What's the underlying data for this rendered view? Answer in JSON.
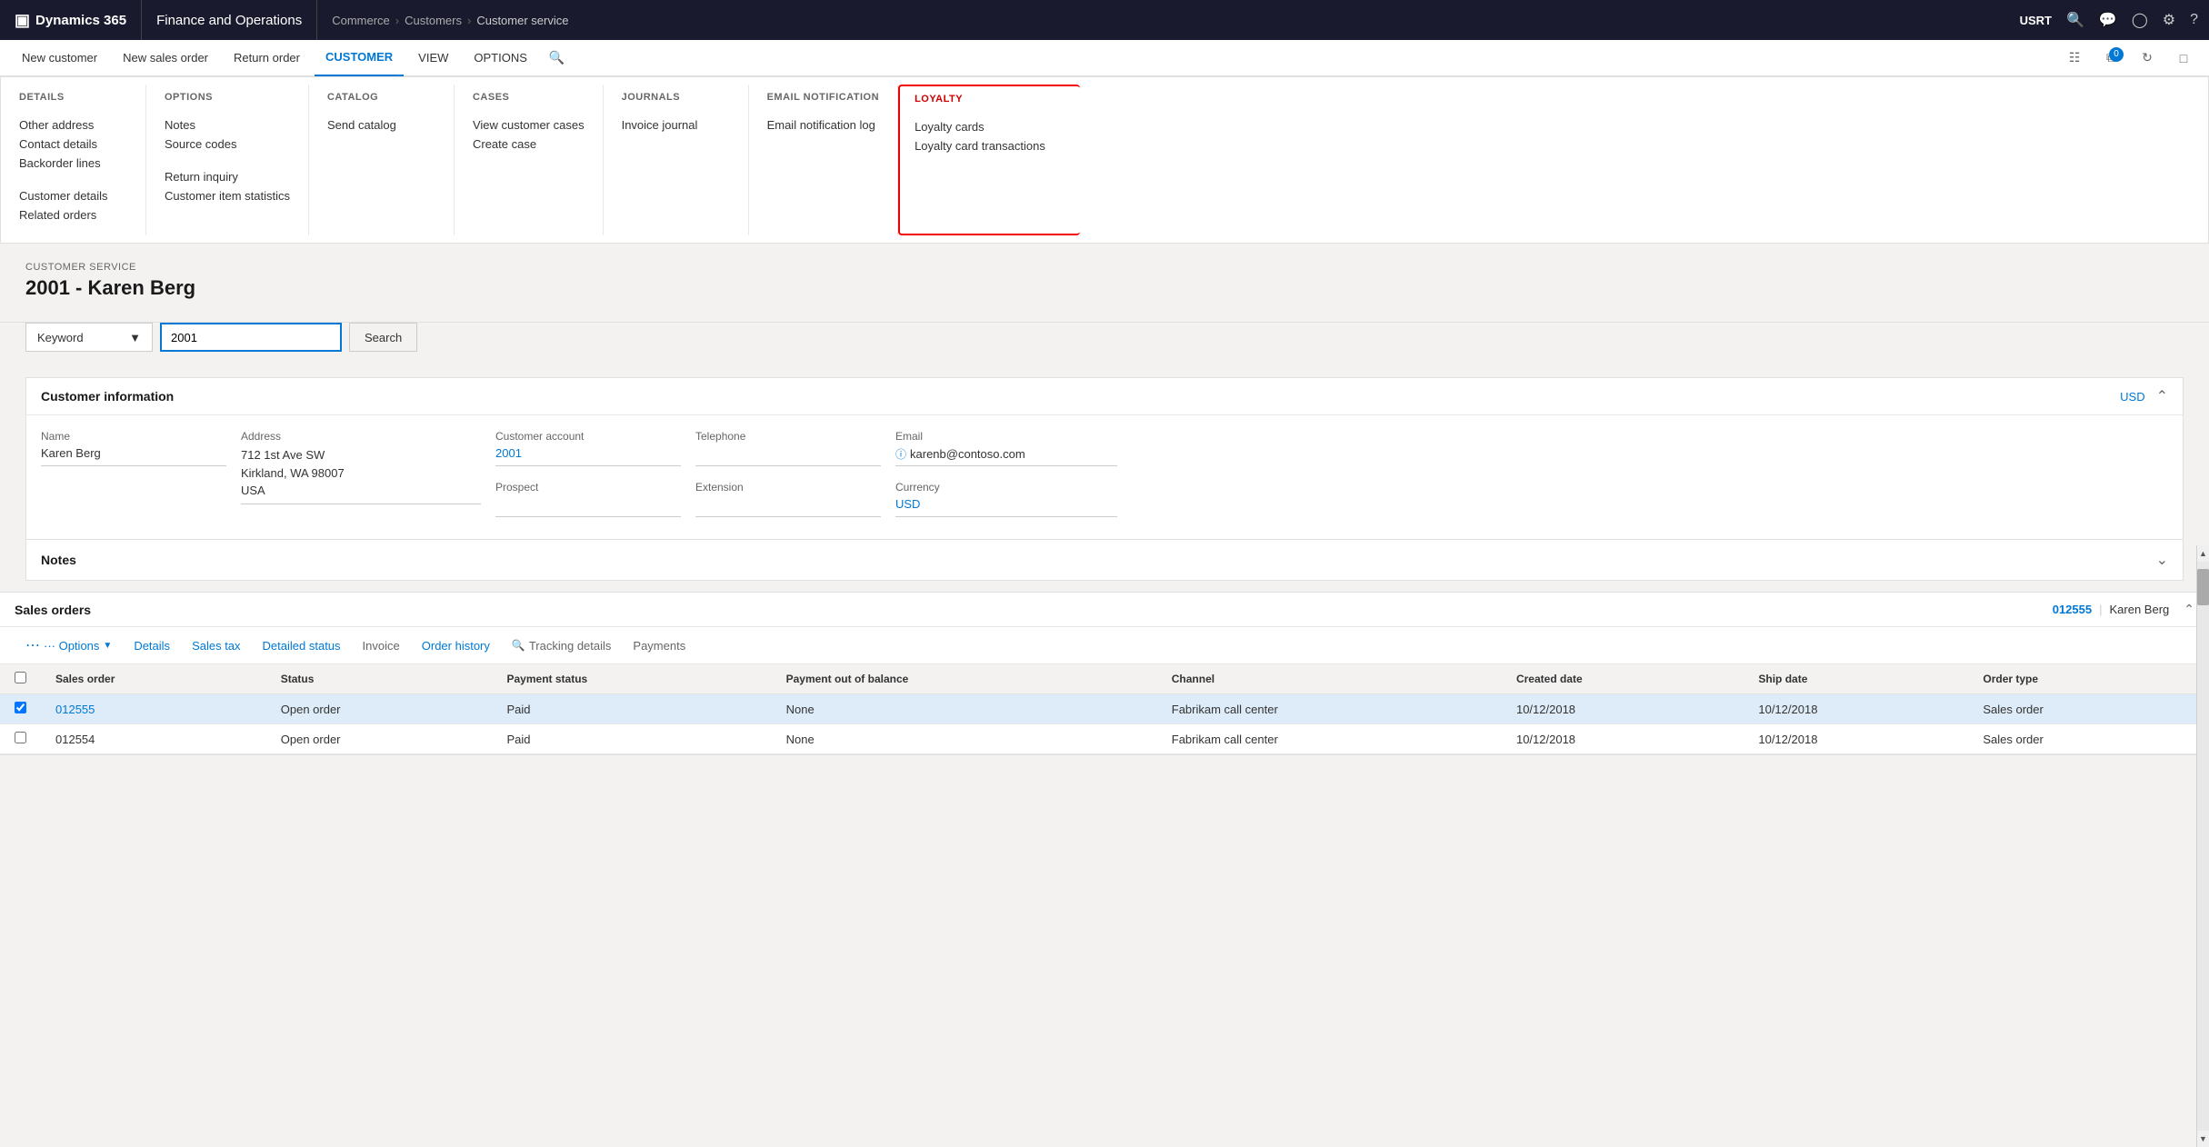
{
  "topbar": {
    "brand": "Dynamics 365",
    "app": "Finance and Operations",
    "breadcrumb": [
      "Commerce",
      "Customers",
      "Customer service"
    ],
    "user": "USRT"
  },
  "ribbon": {
    "items": [
      {
        "label": "New customer",
        "active": false
      },
      {
        "label": "New sales order",
        "active": false
      },
      {
        "label": "Return order",
        "active": false
      },
      {
        "label": "CUSTOMER",
        "active": true
      },
      {
        "label": "VIEW",
        "active": false
      },
      {
        "label": "OPTIONS",
        "active": false
      }
    ]
  },
  "menu": {
    "details": {
      "title": "DETAILS",
      "items": [
        {
          "label": "Other address"
        },
        {
          "label": "Contact details"
        },
        {
          "label": "Backorder lines"
        },
        {
          "label": "Customer details"
        },
        {
          "label": "Related orders"
        }
      ]
    },
    "options": {
      "title": "OPTIONS",
      "items": [
        {
          "label": "Notes"
        },
        {
          "label": "Source codes"
        },
        {
          "label": "Return inquiry"
        },
        {
          "label": "Customer item statistics"
        }
      ]
    },
    "catalog": {
      "title": "CATALOG",
      "items": [
        {
          "label": "Send catalog"
        }
      ]
    },
    "cases": {
      "title": "CASES",
      "items": [
        {
          "label": "View customer cases"
        },
        {
          "label": "Create case"
        }
      ]
    },
    "journals": {
      "title": "JOURNALS",
      "items": [
        {
          "label": "Invoice journal"
        }
      ]
    },
    "email": {
      "title": "EMAIL NOTIFICATION",
      "items": [
        {
          "label": "Email notification log"
        }
      ]
    },
    "loyalty": {
      "title": "LOYALTY",
      "items": [
        {
          "label": "Loyalty cards"
        },
        {
          "label": "Loyalty card transactions"
        }
      ]
    }
  },
  "page": {
    "service_label": "CUSTOMER SERVICE",
    "title": "2001 - Karen Berg"
  },
  "search": {
    "select_label": "Keyword",
    "input_value": "2001",
    "button_label": "Search"
  },
  "customer_info": {
    "section_title": "Customer information",
    "currency_link": "USD",
    "fields": {
      "name_label": "Name",
      "name_value": "Karen Berg",
      "address_label": "Address",
      "address_value": "712 1st Ave SW\nKirkland, WA 98007\nUSA",
      "account_label": "Customer account",
      "account_value": "2001",
      "telephone_label": "Telephone",
      "telephone_value": "",
      "email_label": "Email",
      "email_value": "karenb@contoso.com",
      "prospect_label": "Prospect",
      "prospect_value": "",
      "extension_label": "Extension",
      "extension_value": "",
      "currency_label": "Currency",
      "currency_value": "USD"
    }
  },
  "notes": {
    "section_title": "Notes"
  },
  "sales_orders": {
    "section_title": "Sales orders",
    "order_link": "012555",
    "customer_name": "Karen Berg",
    "toolbar": {
      "options_label": "··· Options",
      "details_label": "Details",
      "sales_tax_label": "Sales tax",
      "detailed_status_label": "Detailed status",
      "invoice_label": "Invoice",
      "order_history_label": "Order history",
      "tracking_details_label": "Tracking details",
      "payments_label": "Payments"
    },
    "columns": [
      "Sales order",
      "Status",
      "Payment status",
      "Payment out of balance",
      "Channel",
      "Created date",
      "Ship date",
      "Order type"
    ],
    "rows": [
      {
        "order": "012555",
        "status": "Open order",
        "payment_status": "Paid",
        "payment_balance": "None",
        "channel": "Fabrikam call center",
        "created": "10/12/2018",
        "ship": "10/12/2018",
        "order_type": "Sales order",
        "selected": true
      },
      {
        "order": "012554",
        "status": "Open order",
        "payment_status": "Paid",
        "payment_balance": "None",
        "channel": "Fabrikam call center",
        "created": "10/12/2018",
        "ship": "10/12/2018",
        "order_type": "Sales order",
        "selected": false
      }
    ]
  }
}
